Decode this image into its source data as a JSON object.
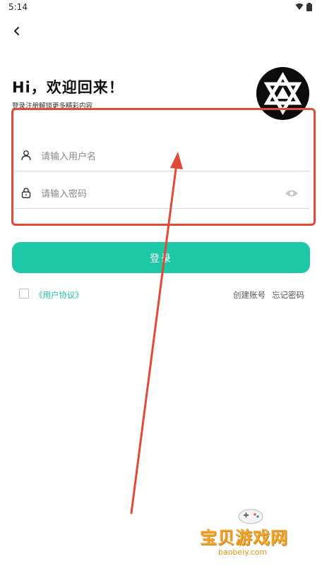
{
  "status_bar": {
    "time": "5:14"
  },
  "header": {
    "title": "Hi，欢迎回来！",
    "subtitle": "登录注册解锁更多精彩内容"
  },
  "form": {
    "username_placeholder": "请输入用户名",
    "password_placeholder": "请输入密码",
    "login_label": "登录"
  },
  "footer": {
    "agreement": "《用户协议》",
    "create_account": "创建账号",
    "forgot_password": "忘记密码"
  },
  "watermark": {
    "text": "宝贝游戏网",
    "url": "baobeiy.com"
  },
  "colors": {
    "accent": "#1cc8a5",
    "annotation": "#e04a36",
    "watermark": "#f2a52a"
  }
}
